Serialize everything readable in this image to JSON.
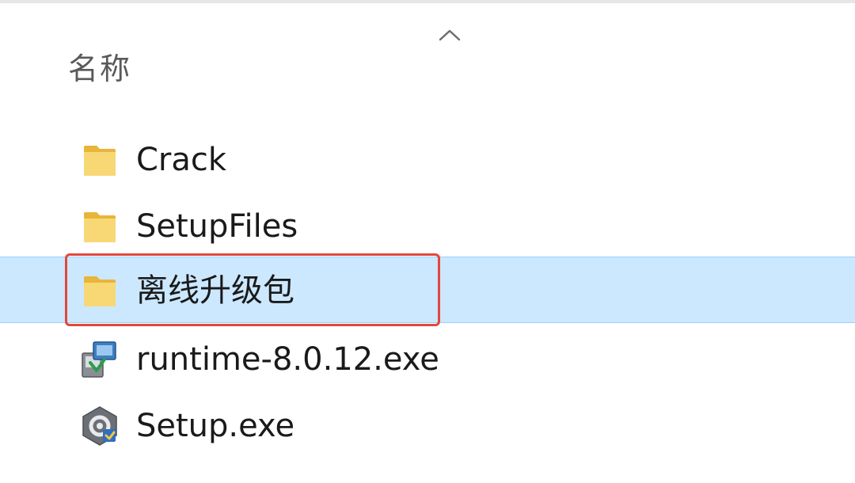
{
  "header": {
    "column_name": "名称",
    "sort_indicator": "chevron-up-icon"
  },
  "files": [
    {
      "name": "Crack",
      "type": "folder",
      "icon": "folder-icon",
      "selected": false
    },
    {
      "name": "SetupFiles",
      "type": "folder",
      "icon": "folder-icon",
      "selected": false
    },
    {
      "name": "离线升级包",
      "type": "folder",
      "icon": "folder-icon",
      "selected": true
    },
    {
      "name": "runtime-8.0.12.exe",
      "type": "exe",
      "icon": "installer-icon",
      "selected": false
    },
    {
      "name": "Setup.exe",
      "type": "exe",
      "icon": "setup-gear-icon",
      "selected": false
    }
  ],
  "colors": {
    "selection_bg": "#cce8ff",
    "selection_border": "#99d1ff",
    "annotation_red": "#e0483c",
    "folder_yellow": "#f8d775"
  }
}
